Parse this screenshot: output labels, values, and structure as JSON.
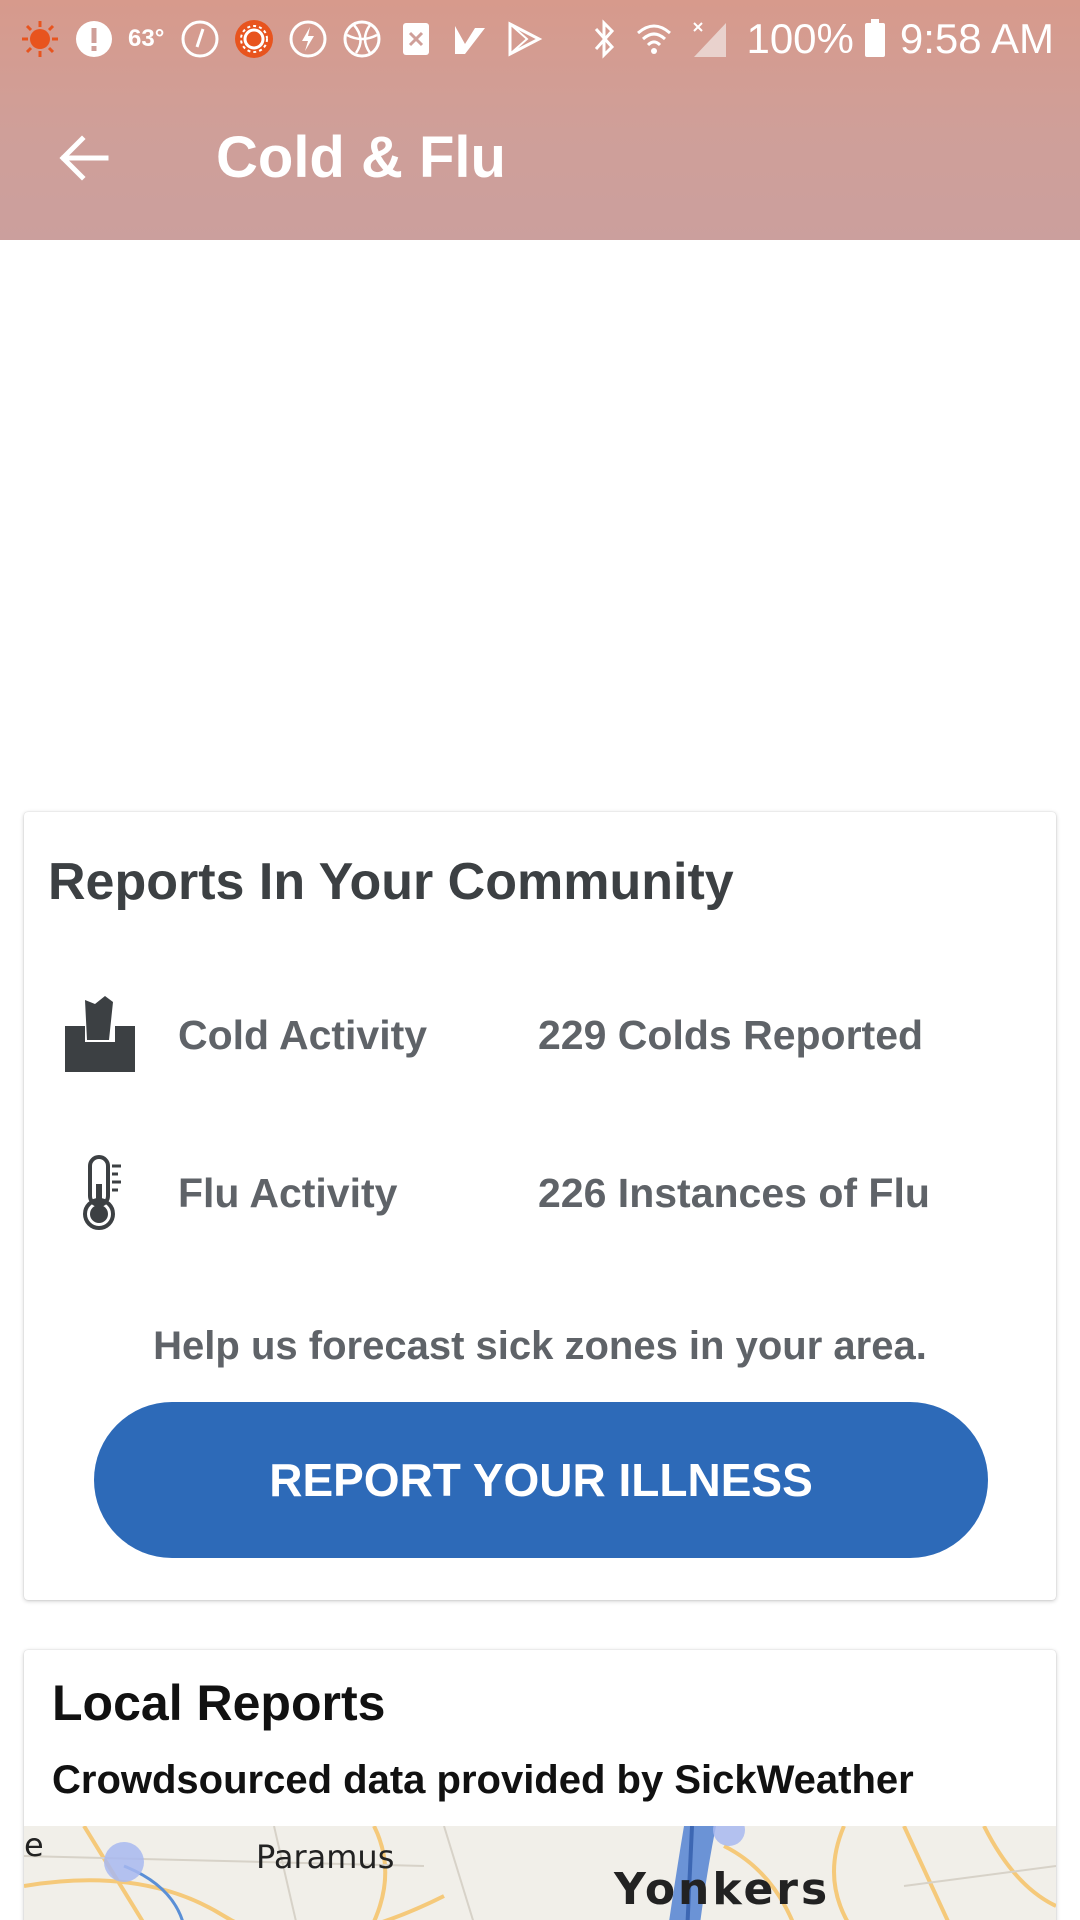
{
  "status_bar": {
    "temperature": "63°",
    "battery": "100%",
    "time": "9:58 AM",
    "icons": [
      "weather-sun-icon",
      "alert-icon",
      "temp-icon",
      "clock-badge-icon",
      "sun-badge-icon",
      "bolt-badge-icon",
      "sport-badge-icon",
      "close-box-icon",
      "tick-flag-icon",
      "play-store-icon",
      "bluetooth-icon",
      "wifi-icon",
      "cell-signal-icon",
      "battery-icon"
    ]
  },
  "app_bar": {
    "title": "Cold & Flu",
    "back_icon": "arrow-back-icon"
  },
  "community": {
    "title": "Reports In Your Community",
    "rows": [
      {
        "icon": "tissue-box-icon",
        "label": "Cold Activity",
        "value": "229 Colds Reported"
      },
      {
        "icon": "thermometer-icon",
        "label": "Flu Activity",
        "value": "226 Instances of Flu"
      }
    ],
    "help_text": "Help us forecast sick zones in your area.",
    "button_label": "REPORT YOUR ILLNESS",
    "button_color": "#2d6ab8"
  },
  "local_reports": {
    "title": "Local Reports",
    "subtitle": "Crowdsourced data provided by SickWeather",
    "map_labels": {
      "edge": "e",
      "paramus": "Paramus",
      "yonkers": "Yonkers"
    }
  },
  "colors": {
    "app_bar": "#cf9f99",
    "status_orange": "#e8541e"
  }
}
